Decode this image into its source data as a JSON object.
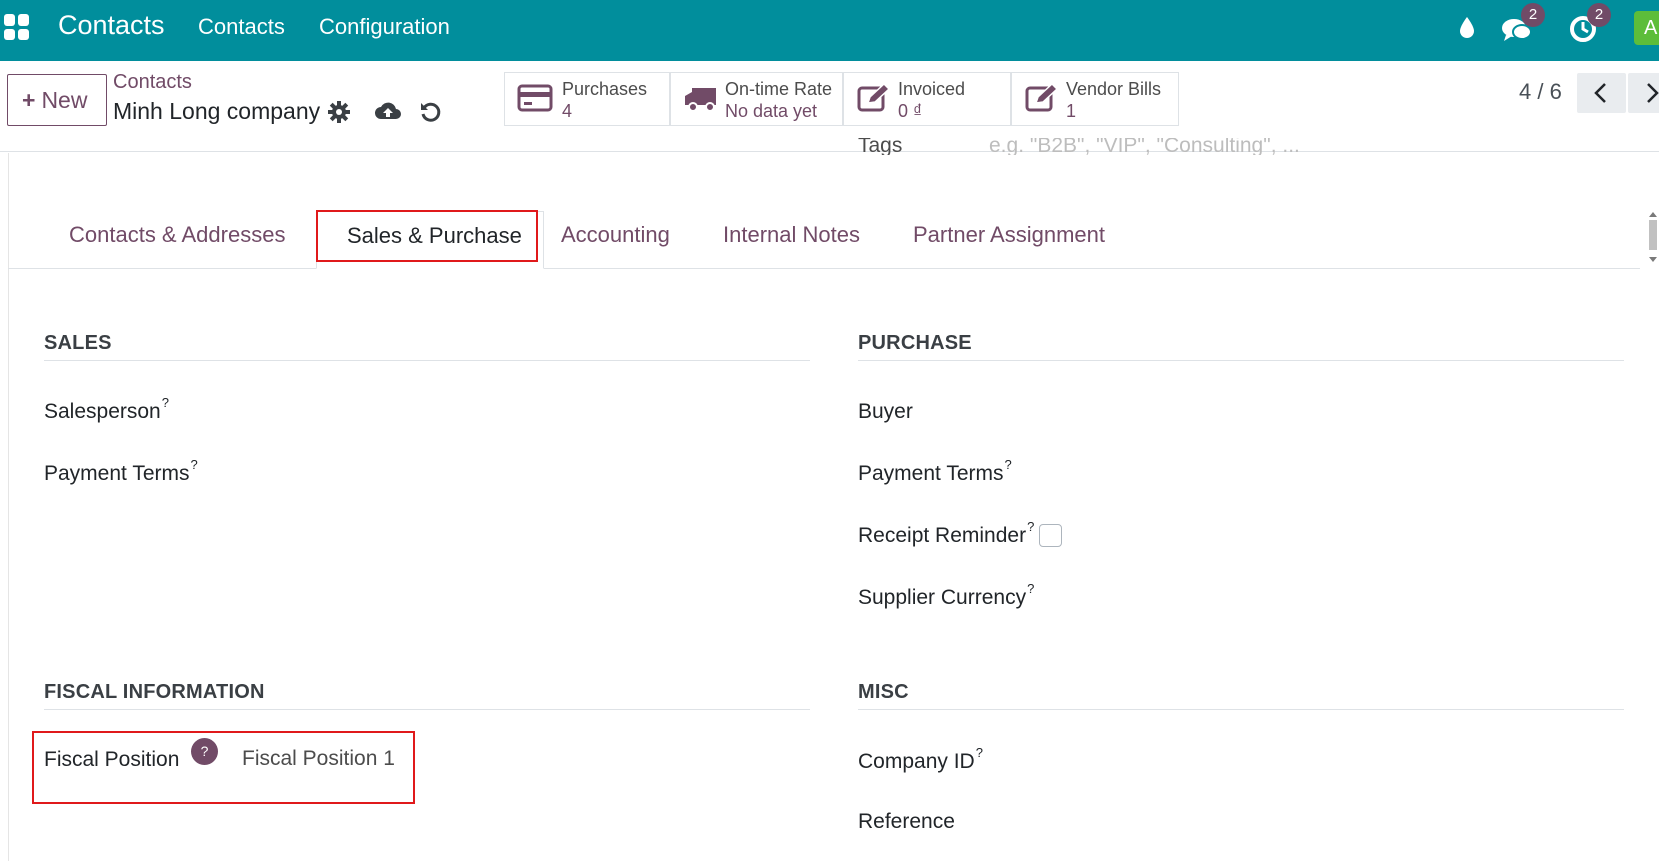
{
  "navbar": {
    "brand": "Contacts",
    "menu": [
      "Contacts",
      "Configuration"
    ],
    "messages_count": "2",
    "activities_count": "2",
    "avatar_initial": "A"
  },
  "control_panel": {
    "new_label": "New",
    "breadcrumb_parent": "Contacts",
    "record_name": "Minh Long company",
    "stats": [
      {
        "label": "Purchases",
        "value": "4",
        "icon": "credit-card-icon"
      },
      {
        "label": "On-time Rate",
        "value": "No data yet",
        "icon": "truck-icon"
      },
      {
        "label": "Invoiced",
        "value": "0 ₫",
        "icon": "pencil-square-icon"
      },
      {
        "label": "Vendor Bills",
        "value": "1",
        "icon": "pencil-square-icon"
      }
    ],
    "pager": "4 / 6"
  },
  "tags_field": {
    "label": "Tags",
    "placeholder": "e.g. \"B2B\", \"VIP\", \"Consulting\", ..."
  },
  "tabs": [
    {
      "label": "Contacts & Addresses",
      "active": false
    },
    {
      "label": "Sales & Purchase",
      "active": true
    },
    {
      "label": "Accounting",
      "active": false
    },
    {
      "label": "Internal Notes",
      "active": false
    },
    {
      "label": "Partner Assignment",
      "active": false
    }
  ],
  "sales": {
    "title": "SALES",
    "salesperson_label": "Salesperson",
    "payment_terms_label": "Payment Terms"
  },
  "purchase": {
    "title": "PURCHASE",
    "buyer_label": "Buyer",
    "payment_terms_label": "Payment Terms",
    "receipt_reminder_label": "Receipt Reminder",
    "supplier_currency_label": "Supplier Currency"
  },
  "fiscal": {
    "title": "FISCAL INFORMATION",
    "fiscal_position_label": "Fiscal Position",
    "fiscal_position_value": "Fiscal Position 1"
  },
  "misc": {
    "title": "MISC",
    "company_id_label": "Company ID",
    "reference_label": "Reference"
  },
  "help_marker": "?",
  "colors": {
    "navbar": "#018e9c",
    "brand_purple": "#714b67",
    "highlight": "#e0191b"
  }
}
